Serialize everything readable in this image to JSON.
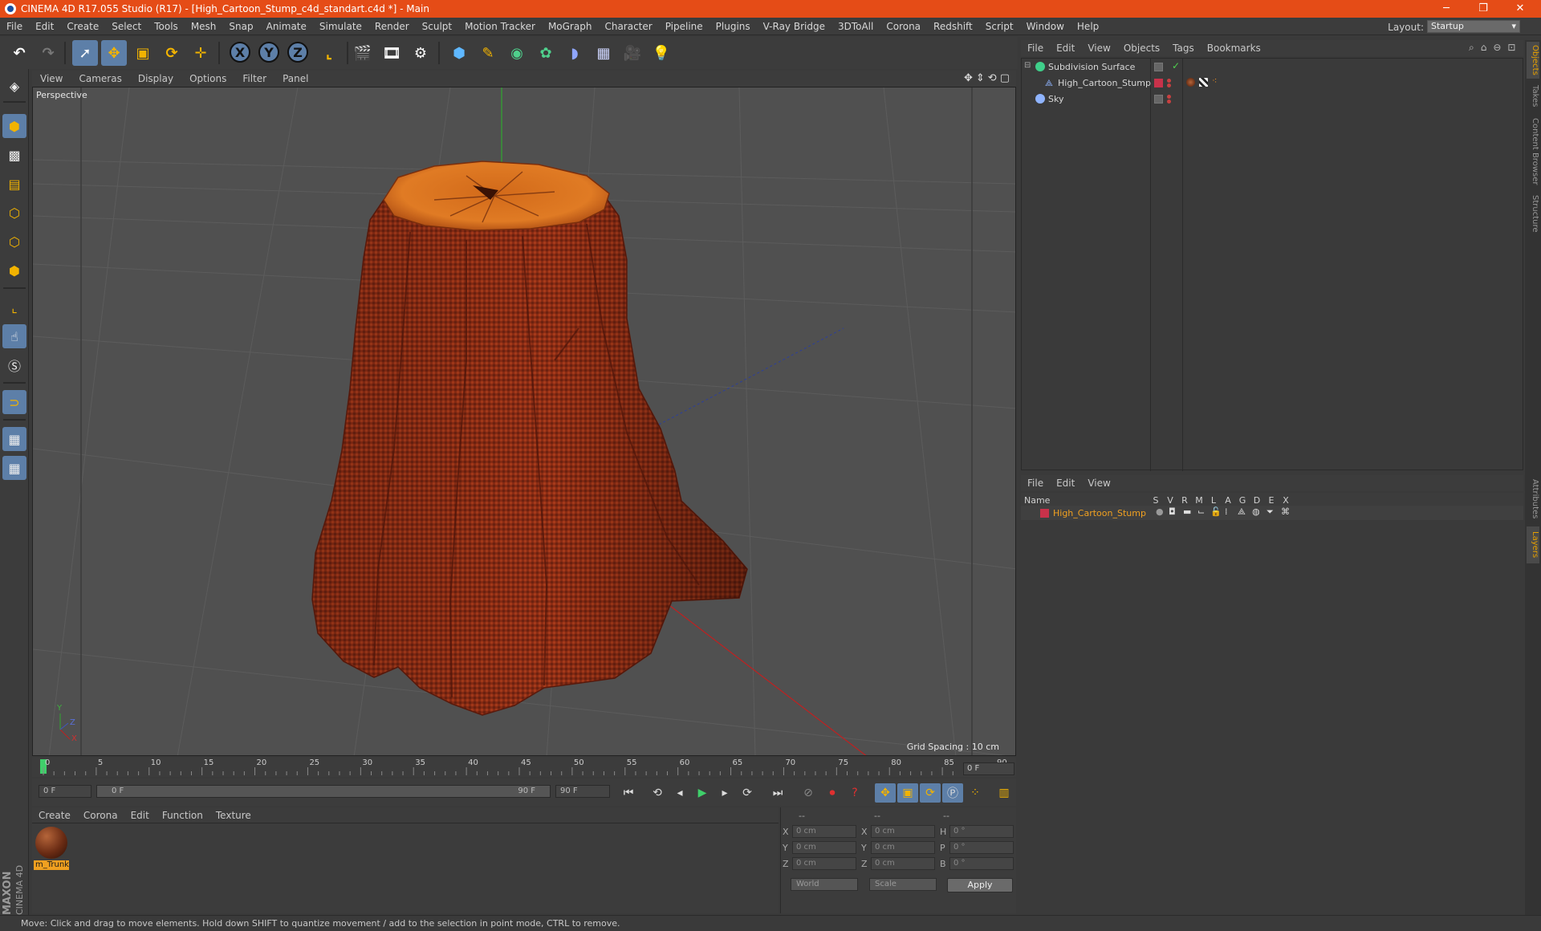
{
  "window": {
    "title": "CINEMA 4D R17.055 Studio (R17) - [High_Cartoon_Stump_c4d_standart.c4d *] - Main",
    "minimize": "─",
    "maximize": "❐",
    "close": "✕"
  },
  "menubar": {
    "items": [
      "File",
      "Edit",
      "Create",
      "Select",
      "Tools",
      "Mesh",
      "Snap",
      "Animate",
      "Simulate",
      "Render",
      "Sculpt",
      "Motion Tracker",
      "MoGraph",
      "Character",
      "Pipeline",
      "Plugins",
      "V-Ray Bridge",
      "3DToAll",
      "Corona",
      "Redshift",
      "Script",
      "Window",
      "Help"
    ],
    "layout_label": "Layout:",
    "layout_value": "Startup"
  },
  "toolbar": {
    "axis_x": "X",
    "axis_y": "Y",
    "axis_z": "Z"
  },
  "viewport": {
    "menu": [
      "View",
      "Cameras",
      "Display",
      "Options",
      "Filter",
      "Panel"
    ],
    "label": "Perspective",
    "grid_spacing": "Grid Spacing : 10 cm",
    "axis_y": "Y",
    "axis_z": "Z",
    "axis_x": "X"
  },
  "timeline": {
    "ticks": [
      "0",
      "5",
      "10",
      "15",
      "20",
      "25",
      "30",
      "35",
      "40",
      "45",
      "50",
      "55",
      "60",
      "65",
      "70",
      "75",
      "80",
      "85",
      "90"
    ],
    "current_frame": "0 F",
    "start_field": "0 F",
    "range_start": "0 F",
    "range_end": "90 F",
    "end_field": "90 F"
  },
  "material_manager": {
    "menu": [
      "Create",
      "Corona",
      "Edit",
      "Function",
      "Texture"
    ],
    "material_name": "m_Trunk"
  },
  "coordinates": {
    "header": [
      "--",
      "--",
      "--"
    ],
    "rows": [
      {
        "axis": "X",
        "pos": "0 cm",
        "axis2": "X",
        "size": "0 cm",
        "rot_label": "H",
        "rot": "0 °"
      },
      {
        "axis": "Y",
        "pos": "0 cm",
        "axis2": "Y",
        "size": "0 cm",
        "rot_label": "P",
        "rot": "0 °"
      },
      {
        "axis": "Z",
        "pos": "0 cm",
        "axis2": "Z",
        "size": "0 cm",
        "rot_label": "B",
        "rot": "0 °"
      }
    ],
    "space": "World",
    "mode": "Scale",
    "apply": "Apply"
  },
  "object_manager": {
    "menu": [
      "File",
      "Edit",
      "View",
      "Objects",
      "Tags",
      "Bookmarks"
    ],
    "objects": [
      {
        "name": "Subdivision Surface"
      },
      {
        "name": "High_Cartoon_Stump"
      },
      {
        "name": "Sky"
      }
    ]
  },
  "layer_manager": {
    "menu": [
      "File",
      "Edit",
      "View"
    ],
    "header_name": "Name",
    "columns": [
      "S",
      "V",
      "R",
      "M",
      "L",
      "A",
      "G",
      "D",
      "E",
      "X"
    ],
    "layer_name": "High_Cartoon_Stump"
  },
  "side_tabs": [
    "Objects",
    "Takes",
    "Content Browser",
    "Structure",
    "Attributes",
    "Layers"
  ],
  "status": "Move: Click and drag to move elements. Hold down SHIFT to quantize movement / add to the selection in point mode, CTRL to remove.",
  "brand": {
    "maxon": "MAXON",
    "cinema": "CINEMA 4D"
  },
  "colors": {
    "title_bar": "#e54c17",
    "accent_blue": "#5d7fa8",
    "highlight_orange": "#f0a020",
    "stump_bark": "#8a2c14",
    "stump_top": "#d9731f"
  }
}
